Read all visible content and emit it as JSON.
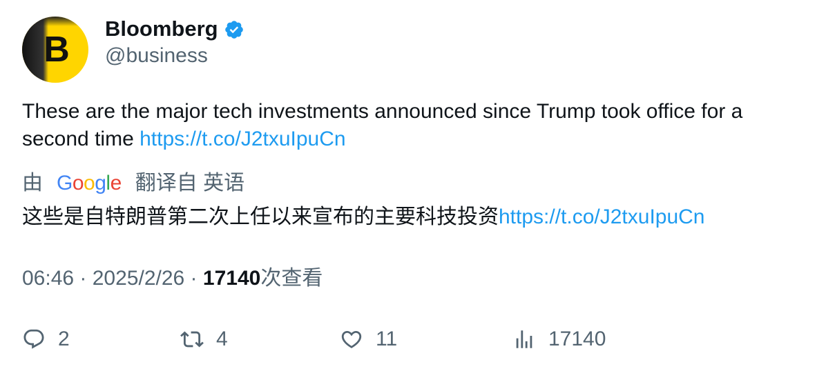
{
  "author": {
    "name": "Bloomberg",
    "handle": "@business",
    "avatar_letter": "B",
    "verified": true
  },
  "tweet": {
    "text": "These are the major tech investments announced since Trump took office for a second time ",
    "link": "https://t.co/J2txuIpuCn"
  },
  "translation": {
    "by_label": "由",
    "provider": "Google",
    "from_label": "翻译自 英语",
    "text": "这些是自特朗普第二次上任以来宣布的主要科技投资",
    "link": "https://t.co/J2txuIpuCn"
  },
  "meta": {
    "time": "06:46",
    "date": "2025/2/26",
    "views_count": "17140",
    "views_label": "次查看"
  },
  "actions": {
    "replies": "2",
    "retweets": "4",
    "likes": "11",
    "views": "17140"
  },
  "colors": {
    "link": "#1d9bf0",
    "secondary": "#536471",
    "avatar_bg": "#ffd500",
    "verified": "#1d9bf0"
  }
}
